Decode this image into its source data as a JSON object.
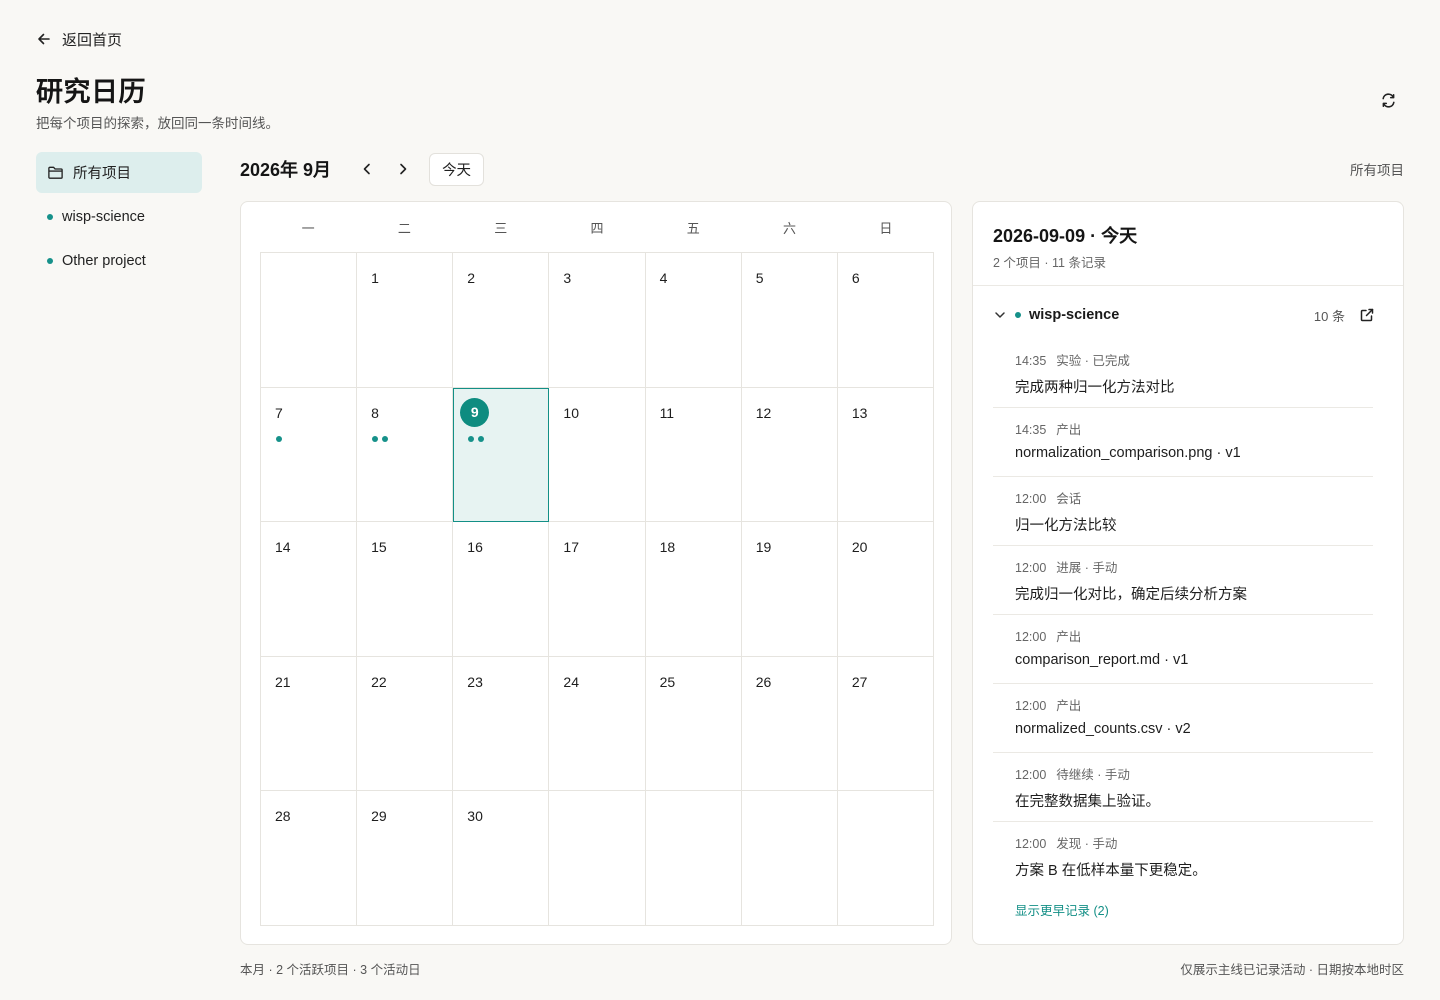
{
  "back_label": "返回首页",
  "page_title": "研究日历",
  "page_subtitle": "把每个项目的探索，放回同一条时间线。",
  "sidebar": {
    "items": [
      {
        "label": "所有项目",
        "icon": "folder-icon",
        "active": true
      },
      {
        "label": "wisp-science",
        "icon": "dot"
      },
      {
        "label": "Other project",
        "icon": "dot"
      }
    ]
  },
  "calendar": {
    "month_label": "2026年 9月",
    "today_label": "今天",
    "filter_label": "所有项目",
    "weekdays": [
      "一",
      "二",
      "三",
      "四",
      "五",
      "六",
      "日"
    ],
    "weeks": [
      [
        {
          "day": ""
        },
        {
          "day": "1"
        },
        {
          "day": "2"
        },
        {
          "day": "3"
        },
        {
          "day": "4"
        },
        {
          "day": "5"
        },
        {
          "day": "6"
        }
      ],
      [
        {
          "day": "7",
          "dots": 1
        },
        {
          "day": "8",
          "dots": 2
        },
        {
          "day": "9",
          "dots": 2,
          "today": true
        },
        {
          "day": "10"
        },
        {
          "day": "11"
        },
        {
          "day": "12"
        },
        {
          "day": "13"
        }
      ],
      [
        {
          "day": "14"
        },
        {
          "day": "15"
        },
        {
          "day": "16"
        },
        {
          "day": "17"
        },
        {
          "day": "18"
        },
        {
          "day": "19"
        },
        {
          "day": "20"
        }
      ],
      [
        {
          "day": "21"
        },
        {
          "day": "22"
        },
        {
          "day": "23"
        },
        {
          "day": "24"
        },
        {
          "day": "25"
        },
        {
          "day": "26"
        },
        {
          "day": "27"
        }
      ],
      [
        {
          "day": "28"
        },
        {
          "day": "29"
        },
        {
          "day": "30"
        },
        {
          "day": ""
        },
        {
          "day": ""
        },
        {
          "day": ""
        },
        {
          "day": ""
        }
      ]
    ],
    "accent_color": "#0e8c80"
  },
  "detail": {
    "date_title": "2026-09-09 · 今天",
    "summary": "2 个项目 · 11 条记录",
    "project": {
      "name": "wisp-science",
      "count": "10 条"
    },
    "entries": [
      {
        "time": "14:35",
        "type": "实验 · 已完成",
        "text": "完成两种归一化方法对比"
      },
      {
        "time": "14:35",
        "type": "产出",
        "text": "normalization_comparison.png · v1"
      },
      {
        "time": "12:00",
        "type": "会话",
        "text": "归一化方法比较"
      },
      {
        "time": "12:00",
        "type": "进展 · 手动",
        "text": "完成归一化对比，确定后续分析方案"
      },
      {
        "time": "12:00",
        "type": "产出",
        "text": "comparison_report.md · v1"
      },
      {
        "time": "12:00",
        "type": "产出",
        "text": "normalized_counts.csv · v2"
      },
      {
        "time": "12:00",
        "type": "待继续 · 手动",
        "text": "在完整数据集上验证。"
      },
      {
        "time": "12:00",
        "type": "发现 · 手动",
        "text": "方案 B 在低样本量下更稳定。"
      }
    ],
    "show_more": "显示更早记录 (2)"
  },
  "footer": {
    "left": "本月 · 2 个活跃项目 · 3 个活动日",
    "right": "仅展示主线已记录活动 · 日期按本地时区"
  }
}
